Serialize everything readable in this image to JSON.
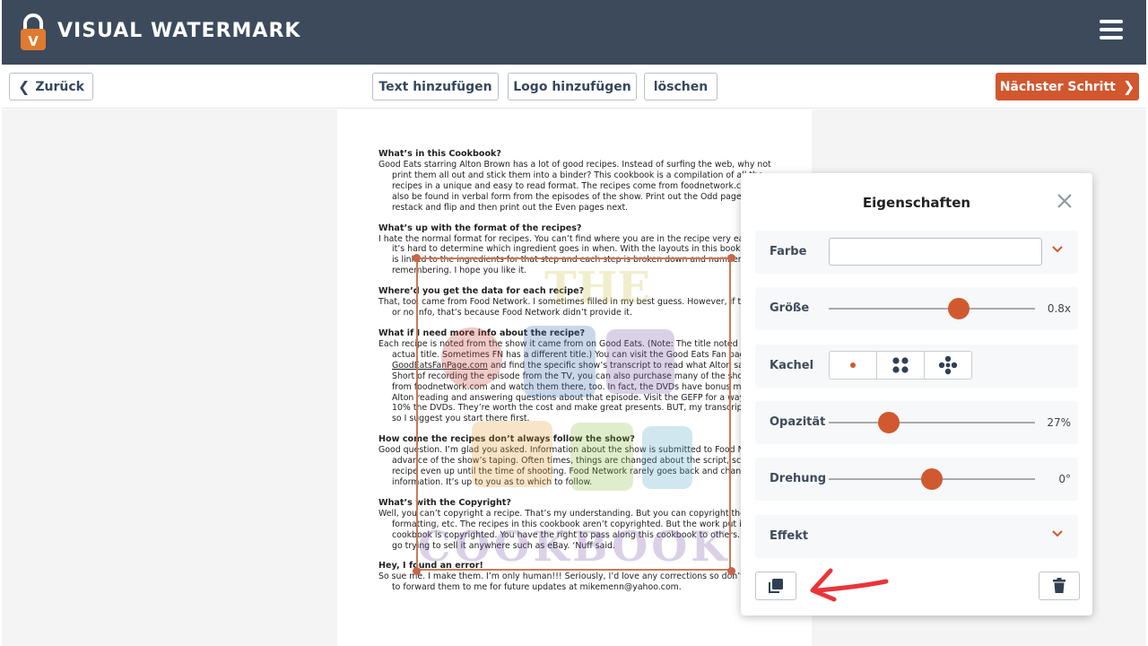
{
  "app": {
    "title": "VISUAL WATERMARK"
  },
  "toolbar": {
    "back_label": "Zurück",
    "add_text_label": "Text hinzufügen",
    "add_logo_label": "Logo hinzufügen",
    "delete_label": "löschen",
    "next_label": "Nächster Schritt"
  },
  "colors": {
    "header_bg": "#3c4a5c",
    "accent": "#d1572f",
    "canvas_bg": "#f4f4f4"
  },
  "document": {
    "sections": [
      {
        "heading": "What’s in this Cookbook?",
        "body": "Good Eats starring Alton Brown has a lot of good recipes. Instead of surfing the web, why not print them all out and stick them into a binder? This cookbook is a compilation of all the recipes in a unique and easy to read format. The recipes come from foodnetwork.com and can also be found in verbal form from the episodes of the show. Print out the Odd pages first, restack and flip and then print out the Even pages next."
      },
      {
        "heading": "What’s up with the format of the recipes?",
        "body": "I hate the normal format for recipes. You can’t find where you are in the recipe very easily and it’s hard to determine which ingredient goes in when. With the layouts in this book, each step is linked to the ingredients for that step and each step is broken down and numbered for easy remembering. I hope you like it."
      },
      {
        "heading": "Where’d you get the data for each recipe?",
        "body": "That, too, came from Food Network. I sometimes filled in my best guess. However, if there is little or no info, that’s because Food Network didn’t provide it."
      },
      {
        "heading": "What if I need more info about the recipe?",
        "body_before_link": "Each recipe is noted from the show it came from on Good Eats. (Note: The title noted is not the actual title. Sometimes FN has a different title.) You can visit the Good Eats Fan page at ",
        "link": "GoodEatsFanPage.com",
        "body_after_link": " and find the specific show’s transcript to read what Alton said about it. Short of recording the episode from the TV, you can also purchase many of the shows on DVD from foodnetwork.com and watch them there, too. In fact, the DVDs have bonus material with Alton reading and answering questions about that episode. Visit the GEFP for a way to get 10% the DVDs. They’re worth the cost and make great presents. BUT, my transcripts are free so I suggest you start there first."
      },
      {
        "heading": "How come the recipes don’t always follow the show?",
        "body": "Good question. I’m glad you asked. Information about the show is submitted to Food Network in advance of the show’s taping. Often times, things are changed about the script, scene and recipe even up until the time of shooting. Food Network rarely goes back and changes their information. It’s up to you as to which to follow."
      },
      {
        "heading": "What’s with the Copyright?",
        "body": "Well, you can’t copyright a recipe. That’s my understanding. But you can copyright the style of formatting, etc. The recipes in this cookbook aren’t copyrighted. But the work put into this cookbook is copyrighted. You have the right to pass along this cookbook to others. But don’t go trying to sell it anywhere such as eBay. ‘Nuff said."
      },
      {
        "heading": "Hey, I found an error!",
        "body": "So sue me. I make them. I’m only human!!! Seriously, I’d love any corrections so don’t hesitate to forward them to me for future updates at mikemenn@yahoo.com."
      }
    ]
  },
  "watermark": {
    "opacity_percent": 27,
    "colors": [
      "#cfc24a",
      "#c4433a",
      "#3a6fb0",
      "#e7a33a",
      "#5aa9c9",
      "#7a5aa8",
      "#8fbf4a"
    ]
  },
  "properties": {
    "title": "Eigenschaften",
    "color": {
      "label": "Farbe",
      "value": ""
    },
    "size": {
      "label": "Größe",
      "value_text": "0.8x",
      "fraction": 0.63
    },
    "tile": {
      "label": "Kachel",
      "options": [
        "single",
        "grid-4",
        "grid-5"
      ],
      "selected": "single"
    },
    "opacity": {
      "label": "Opazität",
      "value_text": "27%",
      "fraction": 0.29
    },
    "rotation": {
      "label": "Drehung",
      "value_text": "0°",
      "fraction": 0.5
    },
    "effect": {
      "label": "Effekt"
    }
  }
}
